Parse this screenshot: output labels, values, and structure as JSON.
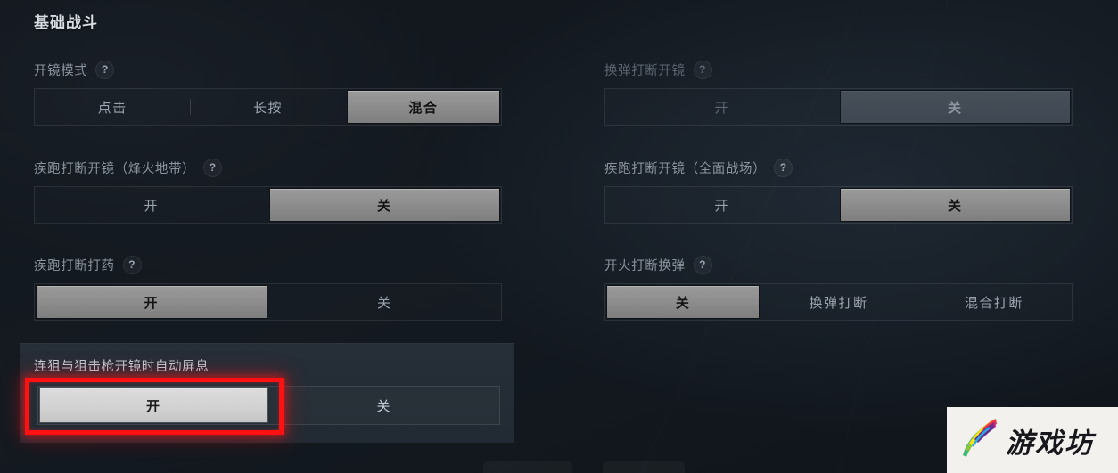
{
  "section": {
    "title": "基础战斗"
  },
  "icons": {
    "help": "?",
    "watermark_bird": "bird-logo-icon"
  },
  "watermark": {
    "text": "游戏坊"
  },
  "rows": [
    {
      "name": "ads-mode",
      "label": "开镜模式",
      "help": "?",
      "dimmed": false,
      "options": [
        "点击",
        "长按",
        "混合"
      ],
      "selected_index": 2
    },
    {
      "name": "reload-cancels-ads",
      "label": "换弹打断开镜",
      "help": "?",
      "dimmed": true,
      "options": [
        "开",
        "关"
      ],
      "selected_index": 1
    },
    {
      "name": "sprint-cancels-ads-fenghuo",
      "label": "疾跑打断开镜（烽火地带）",
      "help": "?",
      "dimmed": false,
      "options": [
        "开",
        "关"
      ],
      "selected_index": 1
    },
    {
      "name": "sprint-cancels-ads-quanmian",
      "label": "疾跑打断开镜（全面战场）",
      "help": "?",
      "dimmed": false,
      "options": [
        "开",
        "关"
      ],
      "selected_index": 1
    },
    {
      "name": "sprint-cancels-heal",
      "label": "疾跑打断打药",
      "help": "?",
      "dimmed": false,
      "options": [
        "开",
        "关"
      ],
      "selected_index": 0
    },
    {
      "name": "fire-cancels-reload",
      "label": "开火打断换弹",
      "help": "?",
      "dimmed": false,
      "options": [
        "关",
        "换弹打断",
        "混合打断"
      ],
      "selected_index": 0
    }
  ],
  "highlighted_row": {
    "name": "auto-hold-breath-sniper",
    "label": "连狙与狙击枪开镜时自动屏息",
    "options": [
      "开",
      "关"
    ],
    "selected_index": 0
  },
  "colors": {
    "background": "#11161c",
    "selected_button": "#8d8d8d",
    "highlight_selected_button": "#d2d2d2",
    "annotation_red": "#ff1111",
    "label_text": "#8b949e",
    "title_text": "#d7dde4",
    "card_background": "#262e38"
  }
}
